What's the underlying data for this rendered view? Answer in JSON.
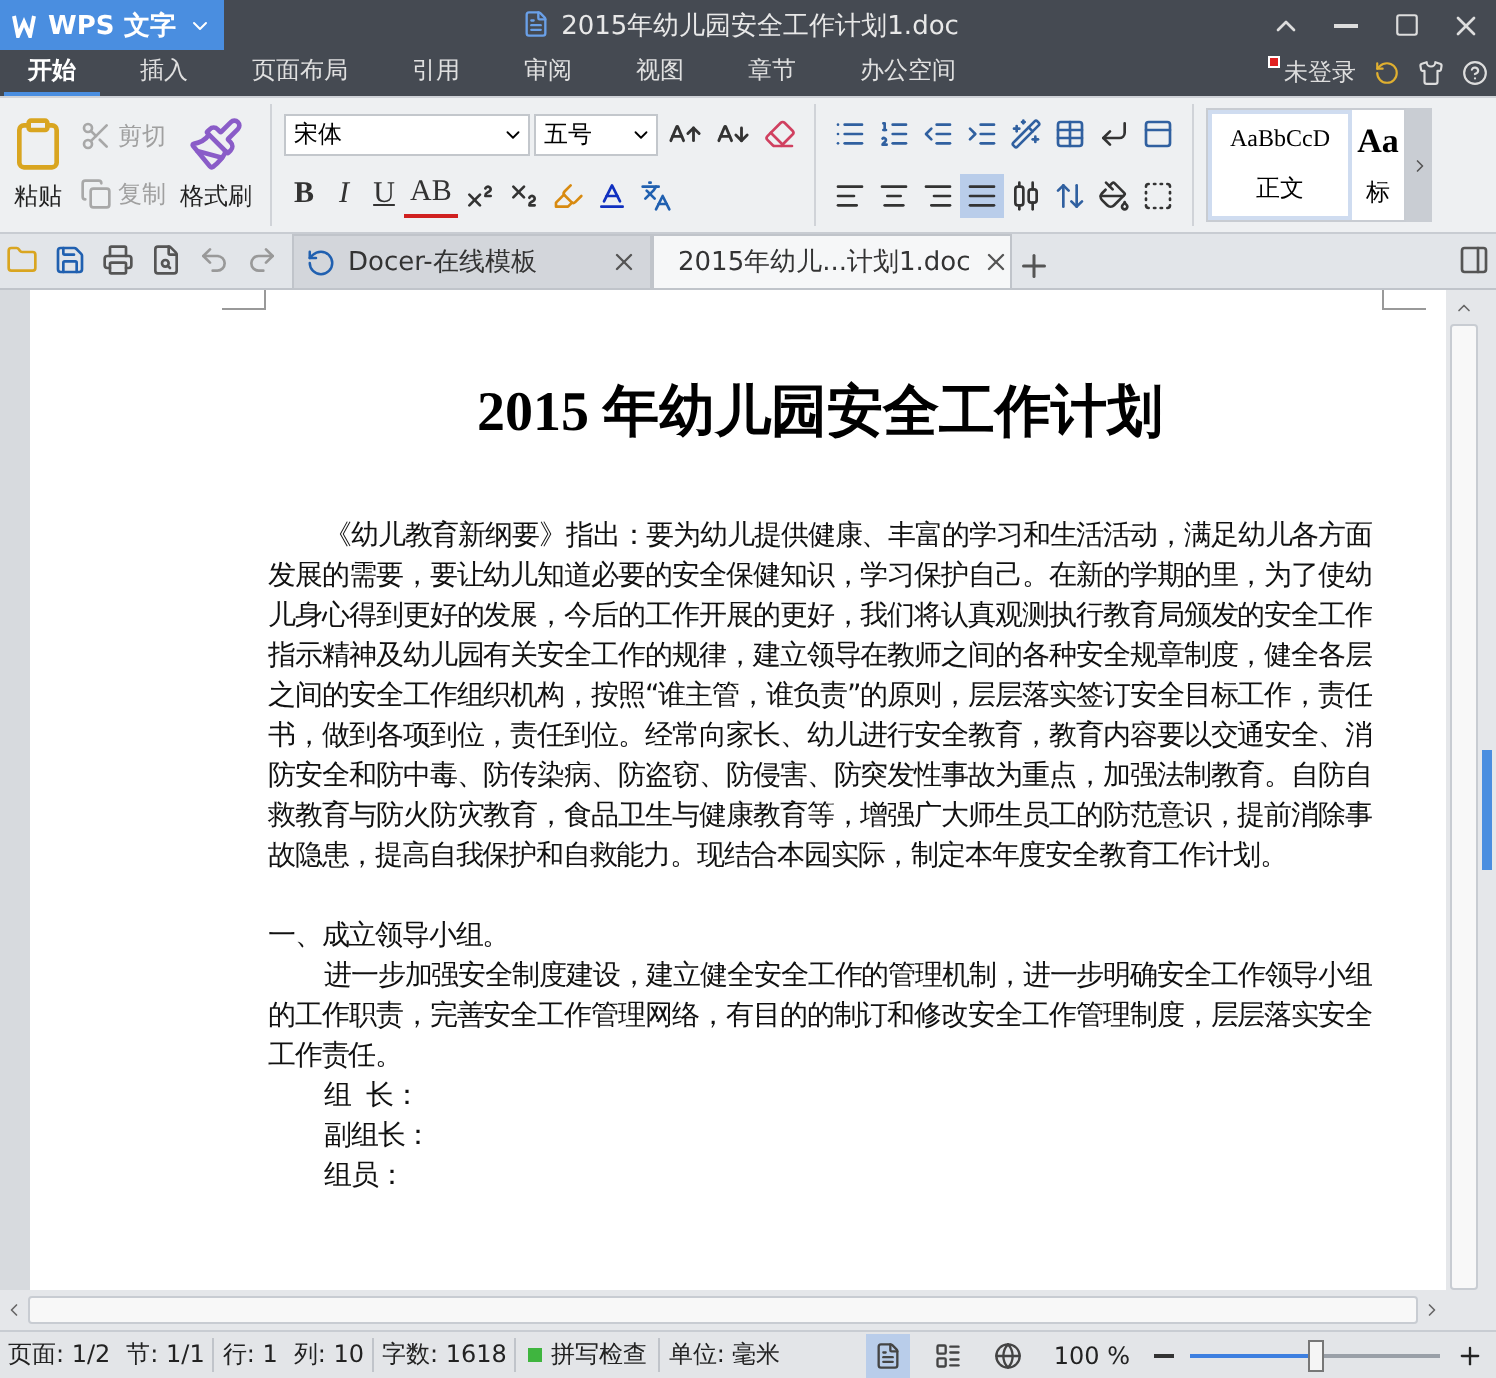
{
  "app_menu": {
    "label": "WPS 文字"
  },
  "window": {
    "title": "2015年幼儿园安全工作计划1.doc"
  },
  "menu_tabs": [
    {
      "label": "开始",
      "selected": true
    },
    {
      "label": "插入",
      "selected": false
    },
    {
      "label": "页面布局",
      "selected": false
    },
    {
      "label": "引用",
      "selected": false
    },
    {
      "label": "审阅",
      "selected": false
    },
    {
      "label": "视图",
      "selected": false
    },
    {
      "label": "章节",
      "selected": false
    },
    {
      "label": "办公空间",
      "selected": false
    }
  ],
  "account": {
    "label": "未登录"
  },
  "clipboard": [
    {
      "kind": "paste",
      "label": "粘贴",
      "disabled": false
    },
    {
      "kind": "cut",
      "label": "剪切",
      "disabled": true
    },
    {
      "kind": "copy",
      "label": "复制",
      "disabled": true
    },
    {
      "kind": "brush",
      "label": "格式刷",
      "disabled": false
    }
  ],
  "font": {
    "family": "宋体",
    "size": "五号"
  },
  "format_buttons": [
    {
      "kind": "bold",
      "label": "B"
    },
    {
      "kind": "italic",
      "label": "I"
    },
    {
      "kind": "underline",
      "label": "U"
    },
    {
      "kind": "strike",
      "label": "AB"
    }
  ],
  "paragraph_align": [
    {
      "kind": "left",
      "selected": false
    },
    {
      "kind": "center",
      "selected": false
    },
    {
      "kind": "right",
      "selected": false
    },
    {
      "kind": "justify",
      "selected": true
    },
    {
      "kind": "distribute",
      "selected": false
    }
  ],
  "styles": [
    {
      "sample": "AaBbCcD",
      "label": "正文",
      "kind": "body",
      "selected": true
    },
    {
      "sample": "Aa",
      "label": "标",
      "kind": "heading",
      "selected": false
    }
  ],
  "doc_tabs": [
    {
      "label": "Docer-在线模板",
      "kind": "docer",
      "selected": false
    },
    {
      "label": "2015年幼儿...计划1.doc",
      "kind": "word",
      "selected": true
    }
  ],
  "document": {
    "title": "2015 年幼儿园安全工作计划",
    "paragraphs": [
      {
        "kind": "body",
        "text": "《幼儿教育新纲要》指出：要为幼儿提供健康、丰富的学习和生活活动，满足幼儿各方面发展的需要，要让幼儿知道必要的安全保健知识，学习保护自己。在新的学期的里，为了使幼儿身心得到更好的发展，今后的工作开展的更好，我们将认真观测执行教育局颁发的安全工作指示精神及幼儿园有关安全工作的规律，建立领导在教师之间的各种安全规章制度，健全各层之间的安全工作组织机构，按照“谁主管，谁负责”的原则，层层落实签订安全目标工作，责任书，做到各项到位，责任到位。经常向家长、幼儿进行安全教育，教育内容要以交通安全、消防安全和防中毒、防传染病、防盗窃、防侵害、防突发性事故为重点，加强法制教育。自防自救教育与防火防灾教育，食品卫生与健康教育等，增强广大师生员工的防范意识，提前消除事故隐患，提高自我保护和自救能力。现结合本园实际，制定本年度安全教育工作计划。"
      },
      {
        "kind": "blank"
      },
      {
        "kind": "heading",
        "text": "一、成立领导小组。"
      },
      {
        "kind": "body",
        "text": "进一步加强安全制度建设，建立健全安全工作的管理机制，进一步明确安全工作领导小组的工作职责，完善安全工作管理网络，有目的的制订和修改安全工作管理制度，层层落实安全工作责任。"
      },
      {
        "kind": "field",
        "text": "组  长："
      },
      {
        "kind": "field",
        "text": "副组长："
      },
      {
        "kind": "field",
        "text": "组员："
      }
    ]
  },
  "status_bar": {
    "items": [
      "页面: 1/2",
      "节: 1/1",
      "行: 1",
      "列: 10",
      "字数: 1618"
    ],
    "spell_check": "拼写检查",
    "unit": "单位: 毫米",
    "view_modes": [
      {
        "kind": "page",
        "selected": true
      },
      {
        "kind": "outline",
        "selected": false
      },
      {
        "kind": "web",
        "selected": false
      }
    ],
    "zoom": {
      "reading": "100 %",
      "level": 0.5
    }
  }
}
